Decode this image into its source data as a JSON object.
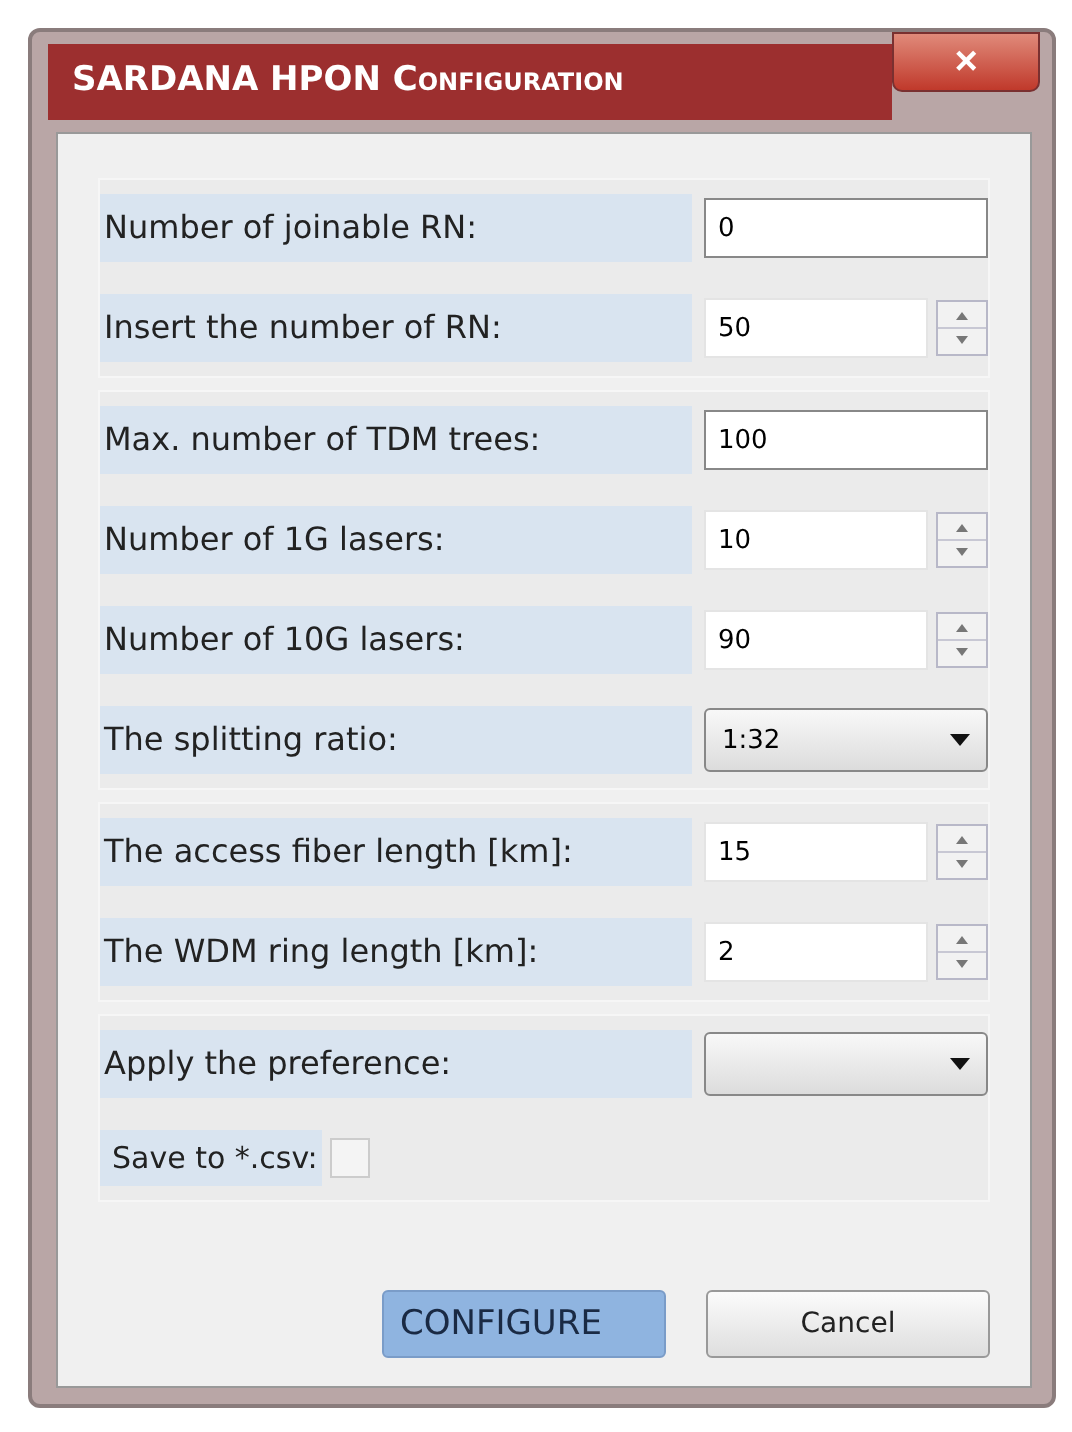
{
  "window": {
    "title": "SARDANA HPON Configuration",
    "close": "×"
  },
  "groups": [
    {
      "rows": [
        {
          "kind": "text",
          "label": "Number of joinable RN:",
          "value": "0"
        },
        {
          "kind": "spin",
          "label": "Insert the number of RN:",
          "value": "50"
        }
      ]
    },
    {
      "rows": [
        {
          "kind": "text",
          "label": "Max. number of TDM trees:",
          "value": "100"
        },
        {
          "kind": "spin",
          "label": "Number of 1G lasers:",
          "value": "10"
        },
        {
          "kind": "spin",
          "label": "Number of 10G lasers:",
          "value": "90"
        },
        {
          "kind": "select",
          "label": "The splitting ratio:",
          "value": "1:32"
        }
      ]
    },
    {
      "rows": [
        {
          "kind": "spin",
          "label": "The access fiber length [km]:",
          "value": "15"
        },
        {
          "kind": "spin",
          "label": "The WDM ring length [km]:",
          "value": "2"
        }
      ]
    },
    {
      "rows": [
        {
          "kind": "select",
          "label": "Apply the preference:"
        },
        {
          "kind": "checkbox",
          "label": "Save to *.csv:",
          "checked": false
        }
      ]
    }
  ],
  "buttons": [
    {
      "label": "CONFIGURE",
      "selected": true
    },
    {
      "label": "Cancel",
      "selected": false
    }
  ]
}
